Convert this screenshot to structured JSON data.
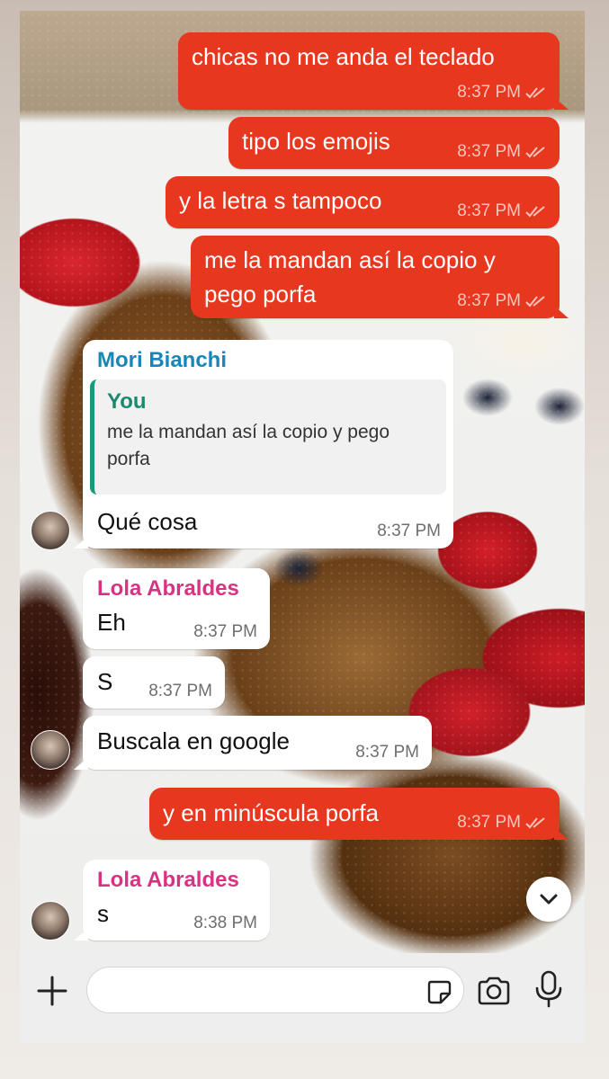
{
  "colors": {
    "outgoing_bubble": "#e8371f",
    "incoming_bubble": "#ffffff",
    "mori_name": "#1a86b8",
    "lola_name": "#d63384",
    "quote_author": "#1a8a6c"
  },
  "messages": [
    {
      "dir": "out",
      "text": "chicas no me anda el teclado",
      "time": "8:37 PM",
      "status": "read-ticks-icon"
    },
    {
      "dir": "out",
      "text": "tipo los emojis",
      "time": "8:37 PM",
      "status": "read-ticks-icon"
    },
    {
      "dir": "out",
      "text": "y la letra s tampoco",
      "time": "8:37 PM",
      "status": "read-ticks-icon"
    },
    {
      "dir": "out",
      "text": "me la mandan así la copio y\npego porfa",
      "time": "8:37 PM",
      "status": "read-ticks-icon"
    },
    {
      "dir": "in",
      "sender": "Mori Bianchi",
      "reply_to": {
        "author": "You",
        "text": "me la mandan así la copio y pego\nporfa"
      },
      "text": "Qué cosa",
      "time": "8:37 PM"
    },
    {
      "dir": "in",
      "sender": "Lola Abraldes",
      "text": "Eh",
      "time": "8:37 PM"
    },
    {
      "dir": "in",
      "text": "S",
      "time": "8:37 PM"
    },
    {
      "dir": "in",
      "text": "Buscala en google",
      "time": "8:37 PM"
    },
    {
      "dir": "out",
      "text": "y en minúscula porfa",
      "time": "8:37 PM",
      "status": "read-ticks-icon"
    },
    {
      "dir": "in",
      "sender": "Lola Abraldes",
      "text": "s",
      "time": "8:38 PM"
    }
  ],
  "composer": {
    "placeholder": "",
    "icons": [
      "plus-icon",
      "sticker-icon",
      "camera-icon",
      "microphone-icon"
    ]
  },
  "scroll_button_icon": "chevron-down-icon"
}
